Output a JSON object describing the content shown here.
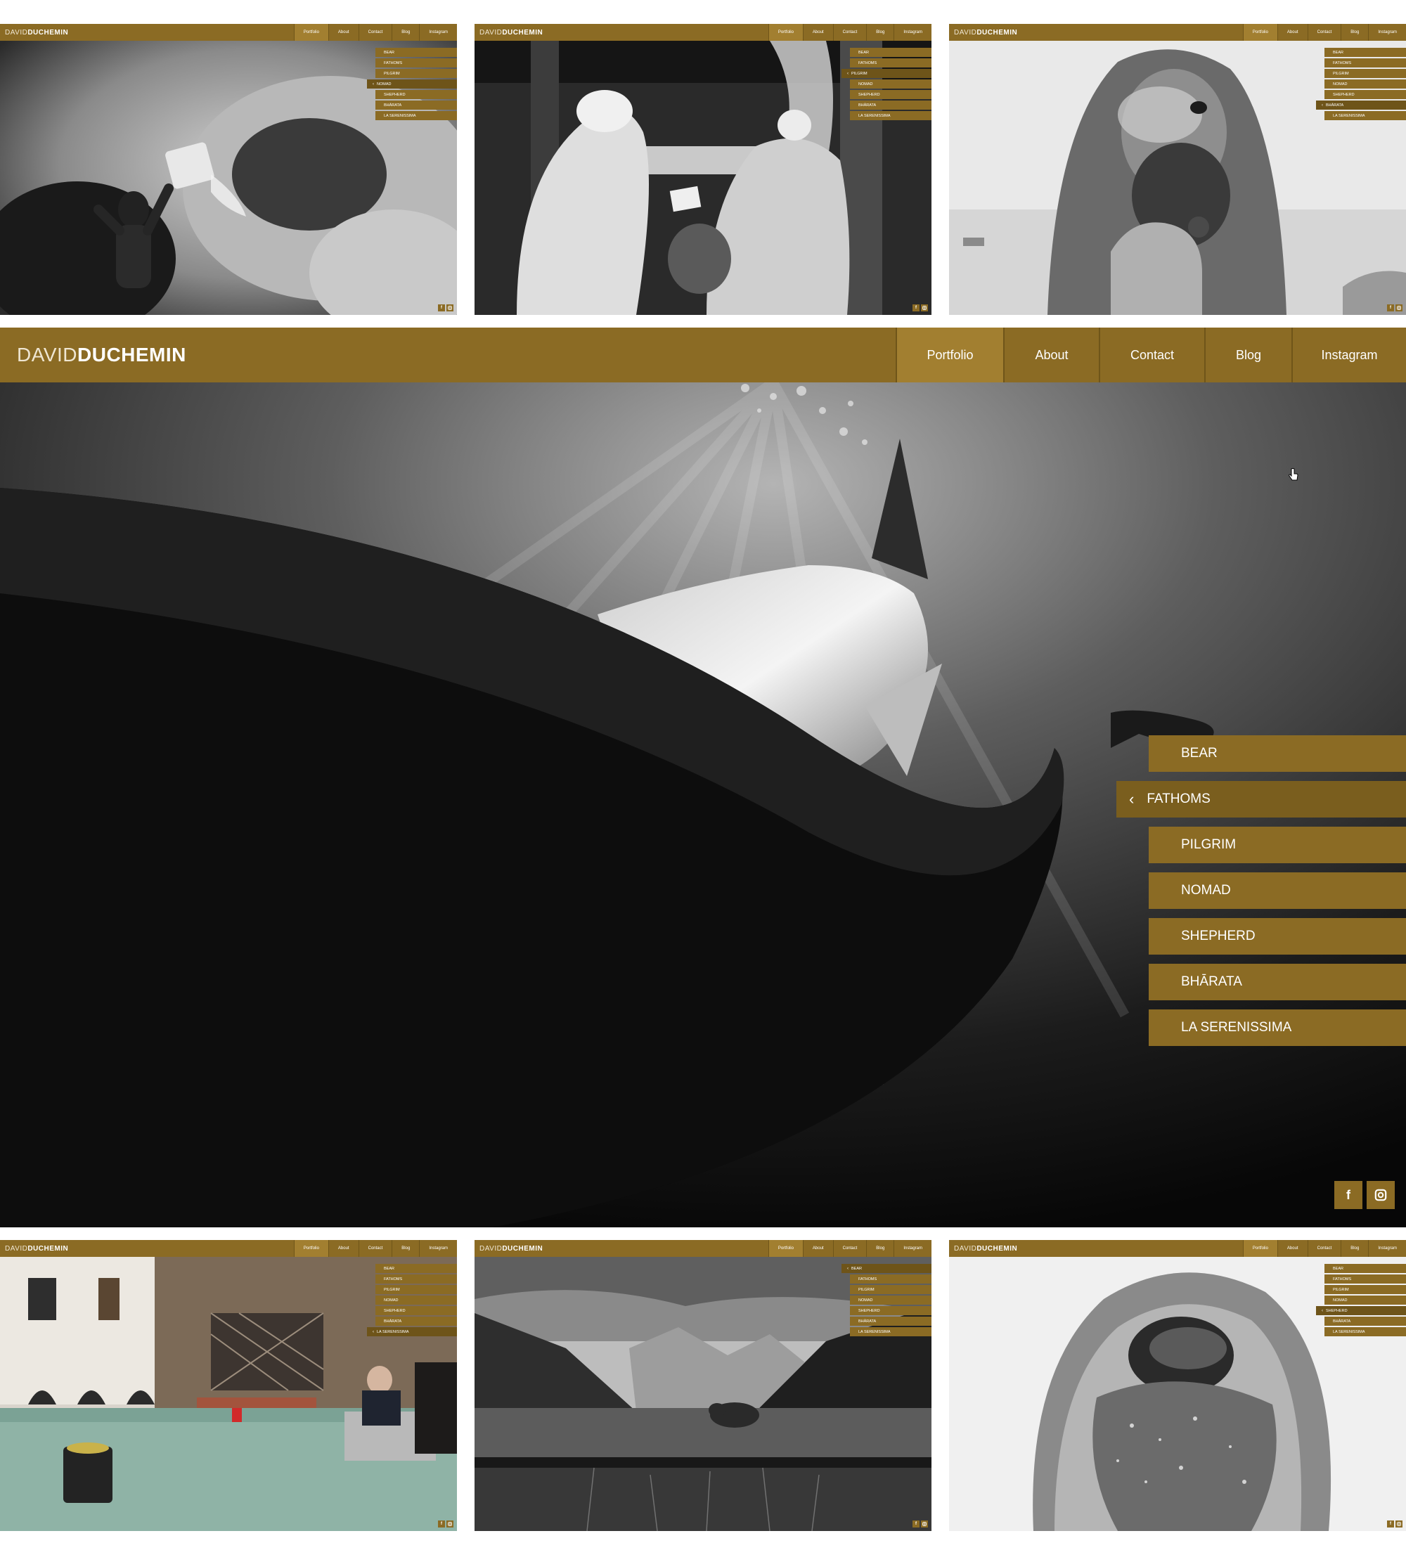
{
  "brand": {
    "light": "DAVID",
    "bold": "DUCHEMIN"
  },
  "nav": [
    "Portfolio",
    "About",
    "Contact",
    "Blog",
    "Instagram"
  ],
  "portfolio_menu": [
    "BEAR",
    "FATHOMS",
    "PILGRIM",
    "NOMAD",
    "SHEPHERD",
    "BHĀRATA",
    "LA SERENISSIMA"
  ],
  "social": {
    "facebook": "f",
    "instagram": "instagram-icon"
  },
  "colors": {
    "gold": "#8b6b24",
    "gold_active": "#a27f30",
    "gold_dark": "#6e5419"
  },
  "frames": [
    {
      "id": "top-left",
      "subject": "pilgrim-water",
      "active_menu": "NOMAD"
    },
    {
      "id": "top-center",
      "subject": "pilgrims-ceremony",
      "active_menu": "PILGRIM"
    },
    {
      "id": "top-right",
      "subject": "sadhu-smoke",
      "active_menu": "BHĀRATA"
    },
    {
      "id": "main",
      "subject": "shark-underwater",
      "active_menu": "FATHOMS"
    },
    {
      "id": "bottom-left",
      "subject": "venice-flood",
      "active_menu": "LA SERENISSIMA"
    },
    {
      "id": "bottom-center",
      "subject": "bear-landscape",
      "active_menu": "BEAR"
    },
    {
      "id": "bottom-right",
      "subject": "frosted-shepherd",
      "active_menu": "SHEPHERD"
    }
  ]
}
